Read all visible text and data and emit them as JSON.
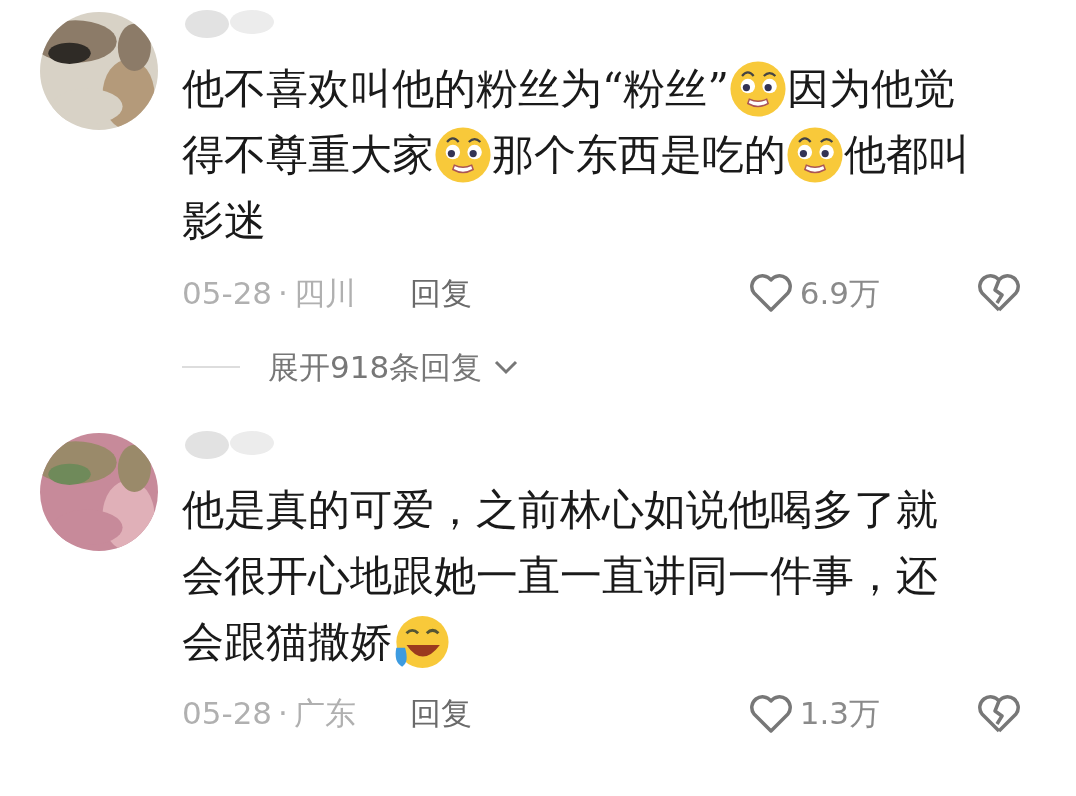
{
  "comments": [
    {
      "lines": [
        [
          {
            "kind": "text",
            "text": "他不喜欢叫他的粉丝为“粉丝”"
          },
          {
            "kind": "worried"
          },
          {
            "kind": "text",
            "text": "因为他觉"
          }
        ],
        [
          {
            "kind": "text",
            "text": "得不尊重大家"
          },
          {
            "kind": "worried"
          },
          {
            "kind": "text",
            "text": "那个东西是吃的"
          },
          {
            "kind": "worried"
          },
          {
            "kind": "text",
            "text": "他都叫"
          }
        ],
        [
          {
            "kind": "text",
            "text": "影迷"
          }
        ]
      ],
      "date": "05-28",
      "separator": "·",
      "location": "四川",
      "reply": "回复",
      "likes": "6.9万",
      "expand": "展开918条回复"
    },
    {
      "lines": [
        [
          {
            "kind": "text",
            "text": "他是真的可爱，之前林心如说他喝多了就"
          }
        ],
        [
          {
            "kind": "text",
            "text": "会很开心地跟她一直一直讲同一件事，还"
          }
        ],
        [
          {
            "kind": "text",
            "text": "会跟猫撒娇"
          },
          {
            "kind": "laughing"
          }
        ]
      ],
      "date": "05-28",
      "separator": "·",
      "location": "广东",
      "reply": "回复",
      "likes": "1.3万"
    }
  ]
}
